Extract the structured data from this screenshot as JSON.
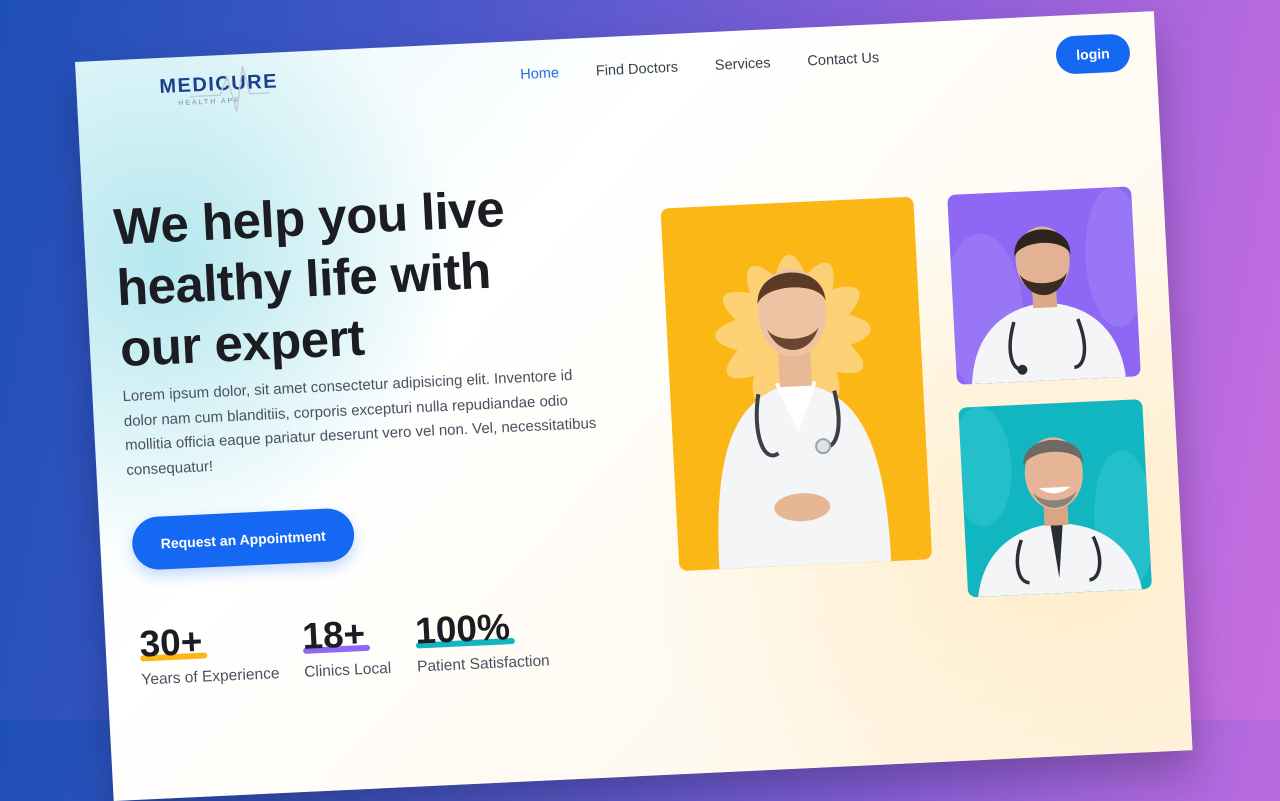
{
  "brand": {
    "name": "MEDICURE",
    "tagline": "HEALTH APP"
  },
  "nav": {
    "links": [
      "Home",
      "Find Doctors",
      "Services",
      "Contact Us"
    ],
    "active": "Home",
    "login_label": "login"
  },
  "hero": {
    "title_line1": "We help you live",
    "title_line2": "healthy life with",
    "title_line3": "our expert",
    "description": "Lorem ipsum dolor, sit amet consectetur adipisicing elit. Inventore id dolor nam cum blanditiis, corporis excepturi nulla repudiandae odio mollitia officia eaque pariatur deserunt vero vel non. Vel, necessitatibus consequatur!",
    "cta_label": "Request an Appointment"
  },
  "stats": [
    {
      "value": "30+",
      "label": "Years of Experience",
      "underline_color": "#fbb715"
    },
    {
      "value": "18+",
      "label": "Clinics Local",
      "underline_color": "#8e68f4"
    },
    {
      "value": "100%",
      "label": "Patient Satisfaction",
      "underline_color": "#12b6c1"
    }
  ],
  "colors": {
    "accent": "#1568f2",
    "photo_yellow": "#fbb715",
    "photo_purple": "#8e68f4",
    "photo_teal": "#12b6c1"
  }
}
